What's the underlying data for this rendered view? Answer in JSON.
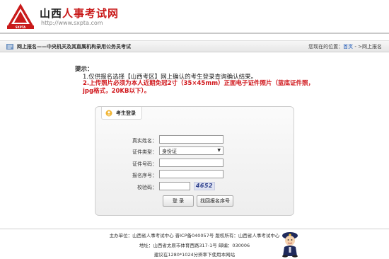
{
  "header": {
    "site_title_part1": "山西",
    "site_title_part2": "人事考试网",
    "site_url": "http://www.sxpta.com",
    "logo_text": "SXPTA"
  },
  "breadcrumb": {
    "title": "网上报名——中央机关及其直属机构录用公务员考试",
    "prefix": "您现在的位置：",
    "home": "首页",
    "separator": " - >",
    "current": "网上报名"
  },
  "notice": {
    "heading": "提示：",
    "item1": "1.仅供报名选择【山西考区】网上确认的考生登录查询确认结果。",
    "item2": "2.上传照片必须为本人近期免冠2寸（35×45mm）正面电子证件照片（蓝底证件照，jpg格式，20KB以下）。"
  },
  "login": {
    "tab_label": "考生登录",
    "name_label": "真实姓名：",
    "name_value": "",
    "idtype_label": "证件类型：",
    "idtype_value": "身份证",
    "idnum_label": "证件号码：",
    "idnum_value": "",
    "regnum_label": "报名序号：",
    "regnum_value": "",
    "captcha_label": "校验码：",
    "captcha_value": "",
    "captcha_image_text": "4652",
    "login_button": "登 录",
    "retrieve_button": "找回报名序号"
  },
  "footer": {
    "line1": "主办单位：山西省人事考试中心   晋ICP备040057号   版权所有：山西省人事考试中心",
    "line2": "地址：山西省太原市体育西路317-1号   邮编：030006",
    "line3": "建议在1280*1024分辨率下使用本网站"
  },
  "colors": {
    "accent_red": "#c91a1a",
    "link_blue": "#1a55b5",
    "warning_red": "#d0161b"
  }
}
